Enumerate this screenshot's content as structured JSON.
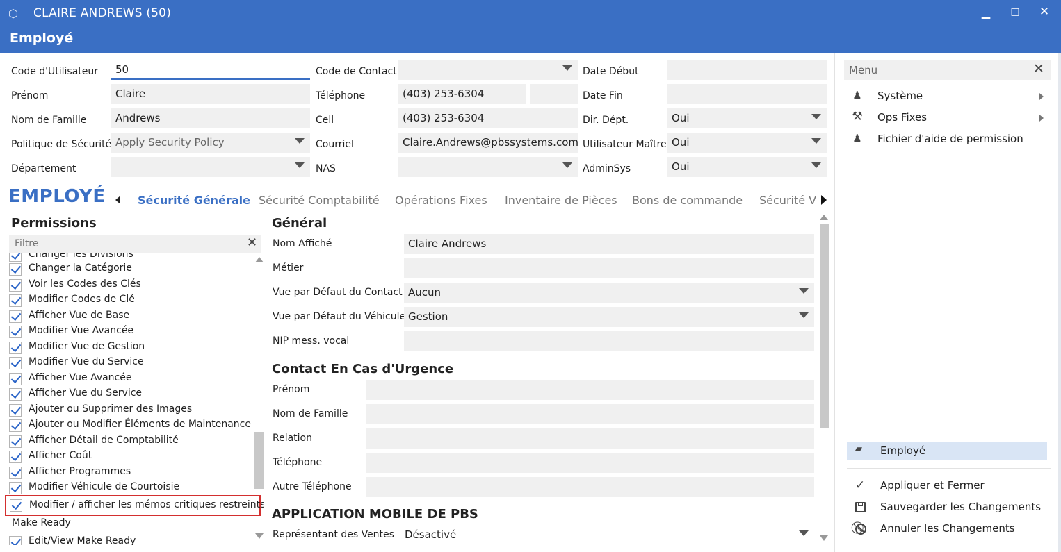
{
  "window": {
    "title": "CLAIRE ANDREWS (50)",
    "subtitle": "Employé",
    "app_icon": "cube-icon",
    "controls": [
      "minimize-icon",
      "maximize-icon",
      "close-icon"
    ]
  },
  "header_form": {
    "col1": [
      {
        "label": "Code d'Utilisateur",
        "value": "50"
      },
      {
        "label": "Prénom",
        "value": "Claire"
      },
      {
        "label": "Nom de Famille",
        "value": "Andrews"
      },
      {
        "label": "Politique de Sécurité",
        "value": "Apply Security Policy"
      },
      {
        "label": "Département",
        "value": ""
      }
    ],
    "col2": [
      {
        "label": "Code de Contact",
        "value": ""
      },
      {
        "label": "Téléphone",
        "value": "(403) 253-6304",
        "ext": ""
      },
      {
        "label": "Cell",
        "value": "(403) 253-6304"
      },
      {
        "label": "Courriel",
        "value": "Claire.Andrews@pbssystems.com"
      },
      {
        "label": "NAS",
        "value": ""
      }
    ],
    "col3": [
      {
        "label": "Date Début",
        "value": ""
      },
      {
        "label": "Date Fin",
        "value": ""
      },
      {
        "label": "Dir. Dépt.",
        "value": "Oui"
      },
      {
        "label": "Utilisateur Maître",
        "value": "Oui"
      },
      {
        "label": "AdminSys",
        "value": "Oui"
      }
    ]
  },
  "tabs": {
    "title": "EMPLOYÉ",
    "items": [
      "Sécurité Générale",
      "Sécurité Comptabilité",
      "Opérations Fixes",
      "Inventaire de Pièces",
      "Bons de commande",
      "Sécurité Ve"
    ]
  },
  "permissions": {
    "heading": "Permissions",
    "filter_placeholder": "Filtre",
    "partial_top": "Changer les Divisions",
    "items": [
      "Changer la Catégorie",
      "Voir les Codes des Clés",
      "Modifier Codes de Clé",
      "Afficher Vue de Base",
      "Modifier Vue Avancée",
      "Modifier Vue de Gestion",
      "Modifier Vue du Service",
      "Afficher Vue Avancée",
      "Afficher Vue du Service",
      "Ajouter ou Supprimer des Images",
      "Ajouter ou Modifier Éléments de Maintenance",
      "Afficher Détail de Comptabilité",
      "Afficher Coût",
      "Afficher Programmes",
      "Modifier Véhicule de Courtoisie",
      "Modifier / afficher les mémos critiques restreints"
    ],
    "group_label": "Make Ready",
    "partial_bottom": "Edit/View Make Ready"
  },
  "general": {
    "heading": "Général",
    "fields": [
      {
        "label": "Nom Affiché",
        "value": "Claire Andrews"
      },
      {
        "label": "Métier",
        "value": ""
      },
      {
        "label": "Vue par Défaut du Contact",
        "value": "Aucun"
      },
      {
        "label": "Vue par Défaut du Véhicule",
        "value": "Gestion"
      },
      {
        "label": "NIP mess. vocal",
        "value": ""
      }
    ],
    "emergency_heading": "Contact En Cas d'Urgence",
    "emergency_fields": [
      {
        "label": "Prénom",
        "value": ""
      },
      {
        "label": "Nom de Famille",
        "value": ""
      },
      {
        "label": "Relation",
        "value": ""
      },
      {
        "label": "Téléphone",
        "value": ""
      },
      {
        "label": "Autre Téléphone",
        "value": ""
      }
    ],
    "mobile_heading": "APPLICATION MOBILE DE PBS",
    "mobile_fields": [
      {
        "label": "Représentant des Ventes",
        "value": "Désactivé"
      }
    ]
  },
  "menu": {
    "title": "Menu",
    "items": [
      {
        "label": "Système",
        "icon": "user-group-icon"
      },
      {
        "label": "Ops Fixes",
        "icon": "tools-icon"
      },
      {
        "label": "Fichier d'aide de permission",
        "icon": "user-group-icon"
      }
    ],
    "context": {
      "label": "Employé",
      "icon": "folder-open-icon"
    },
    "actions": [
      {
        "label": "Appliquer et Fermer",
        "icon": "check-icon"
      },
      {
        "label": "Sauvegarder les Changements",
        "icon": "save-icon"
      },
      {
        "label": "Annuler les Changements",
        "icon": "cancel-icon"
      }
    ]
  },
  "colors": {
    "accent": "#3a6fc4",
    "highlight_border": "#d32f2f",
    "selected_bg": "#d9e5f5"
  }
}
